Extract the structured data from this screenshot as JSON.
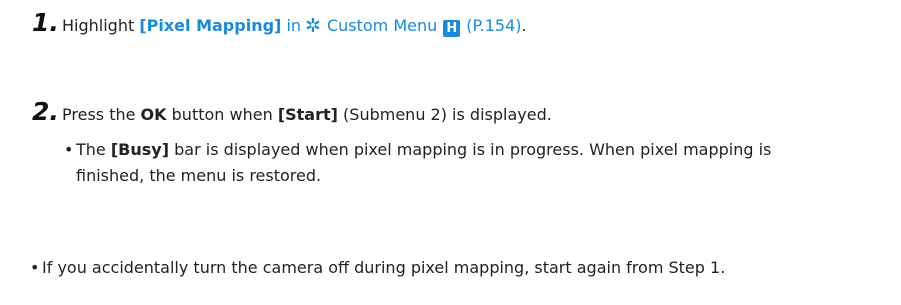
{
  "steps": [
    {
      "number": "1.",
      "text_before": "Highlight",
      "menu_item": "[Pixel Mapping]",
      "in_text": "in",
      "gear_icon": "gear-icon",
      "menu_name": "Custom Menu",
      "menu_badge": "H",
      "page_ref": "(P.154)",
      "period": "."
    },
    {
      "number": "2.",
      "text_before": "Press the",
      "ok_label": "OK",
      "text_mid": "button when",
      "start_label": "[Start]",
      "text_after": "(Submenu 2) is displayed.",
      "bullet": {
        "dot": "•",
        "text_before": "The",
        "busy_label": "[Busy]",
        "line1_rest": "bar is displayed when pixel mapping is in progress. When pixel mapping is",
        "line2": "finished, the menu is restored."
      }
    }
  ],
  "note": {
    "dot": "•",
    "text": "If you accidentally turn the camera off during pixel mapping, start again from Step 1."
  },
  "colors": {
    "link": "#1a8ad8",
    "text": "#222222"
  }
}
